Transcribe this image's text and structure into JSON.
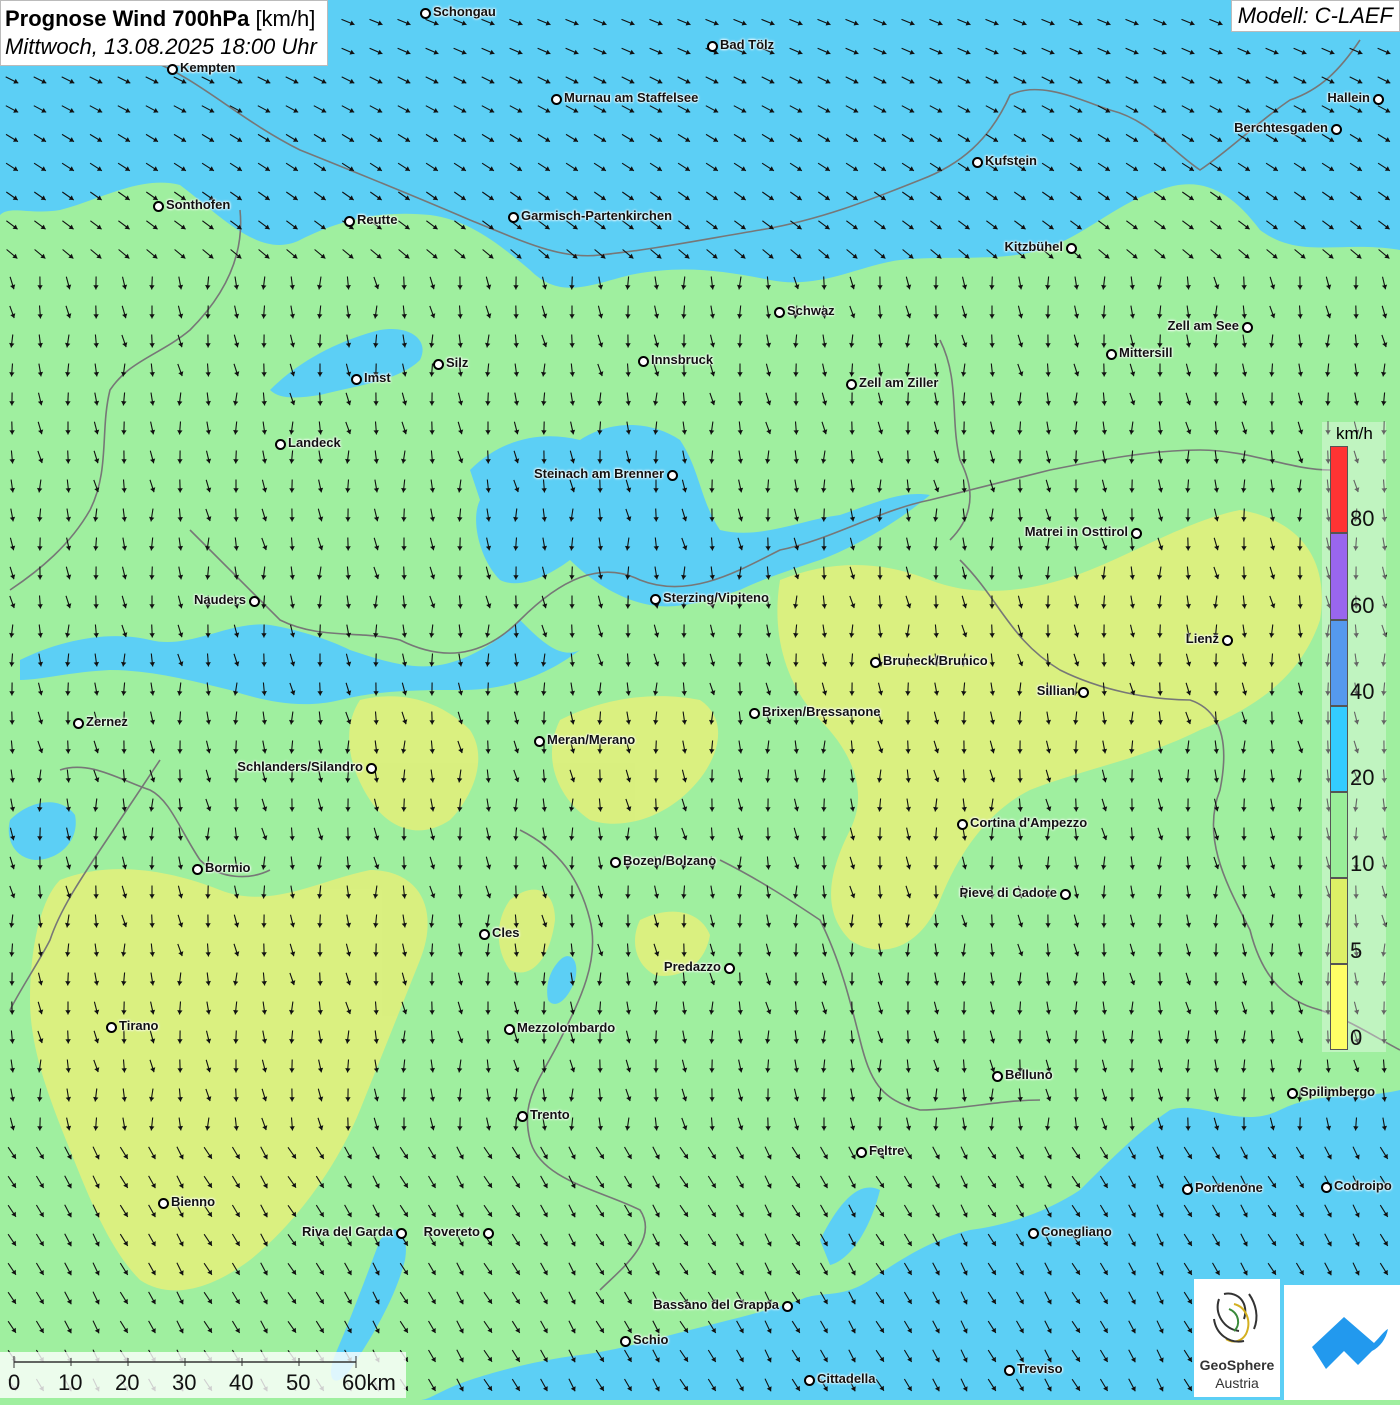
{
  "title": {
    "bold": "Prognose Wind 700hPa",
    "unit": "[km/h]",
    "subtitle": "Mittwoch, 13.08.2025 18:00 Uhr"
  },
  "model": "Modell: C-LAEF",
  "legend": {
    "unit": "km/h",
    "labels": [
      "80",
      "60",
      "40",
      "20",
      "10",
      "5",
      "0"
    ],
    "colors": [
      "#ff3333",
      "#9966ee",
      "#5599ee",
      "#33ccff",
      "#99ee99",
      "#ddf066",
      "#ffff66"
    ]
  },
  "scale": {
    "labels": [
      "0",
      "10",
      "20",
      "30",
      "40",
      "50",
      "60km"
    ]
  },
  "logos": {
    "geosphere_name": "GeoSphere",
    "geosphere_sub": "Austria"
  },
  "cities": [
    {
      "name": "Schongau"
    },
    {
      "name": "Bad Tölz"
    },
    {
      "name": "Kempten"
    },
    {
      "name": "Murnau am Staffelsee"
    },
    {
      "name": "Hallein"
    },
    {
      "name": "Berchtesgaden"
    },
    {
      "name": "Kufstein"
    },
    {
      "name": "Sonthofen"
    },
    {
      "name": "Reutte"
    },
    {
      "name": "Garmisch-Partenkirchen"
    },
    {
      "name": "Kitzbühel"
    },
    {
      "name": "Schwaz"
    },
    {
      "name": "Zell am See"
    },
    {
      "name": "Mittersill"
    },
    {
      "name": "Innsbruck"
    },
    {
      "name": "Imst"
    },
    {
      "name": "Silz"
    },
    {
      "name": "Zell am Ziller"
    },
    {
      "name": "Landeck"
    },
    {
      "name": "Steinach am Brenner"
    },
    {
      "name": "Matrei in Osttirol"
    },
    {
      "name": "Nauders"
    },
    {
      "name": "Sterzing/Vipiteno"
    },
    {
      "name": "Lienz"
    },
    {
      "name": "Bruneck/Brunico"
    },
    {
      "name": "Sillian"
    },
    {
      "name": "Zernez"
    },
    {
      "name": "Brixen/Bressanone"
    },
    {
      "name": "Meran/Merano"
    },
    {
      "name": "Schlanders/Silandro"
    },
    {
      "name": "Cortina d'Ampezzo"
    },
    {
      "name": "Bozen/Bolzano"
    },
    {
      "name": "Bormio"
    },
    {
      "name": "Pieve di Cadore"
    },
    {
      "name": "Cles"
    },
    {
      "name": "Predazzo"
    },
    {
      "name": "Tirano"
    },
    {
      "name": "Mezzolombardo"
    },
    {
      "name": "Belluno"
    },
    {
      "name": "Spilimbergo"
    },
    {
      "name": "Trento"
    },
    {
      "name": "Feltre"
    },
    {
      "name": "Bienno"
    },
    {
      "name": "Pordenone"
    },
    {
      "name": "Codroipo"
    },
    {
      "name": "Riva del Garda"
    },
    {
      "name": "Rovereto"
    },
    {
      "name": "Conegliano"
    },
    {
      "name": "Bassano del Grappa"
    },
    {
      "name": "Schio"
    },
    {
      "name": "Treviso"
    },
    {
      "name": "Cittadella"
    }
  ]
}
